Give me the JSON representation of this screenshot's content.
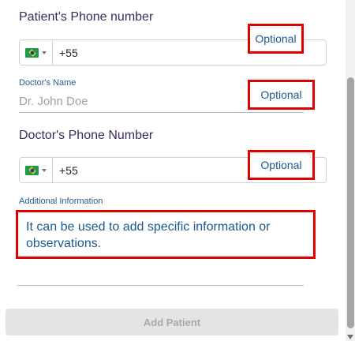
{
  "patient_phone": {
    "label": "Patient's Phone number",
    "country_flag": "brazil-flag-icon",
    "value": "+55",
    "optional_tag": "Optional"
  },
  "doctor_name": {
    "label": "Doctor's Name",
    "placeholder": "Dr. John Doe",
    "optional_tag": "Optional"
  },
  "doctor_phone": {
    "label": "Doctor's Phone Number",
    "country_flag": "brazil-flag-icon",
    "value": "+55",
    "optional_tag": "Optional"
  },
  "additional_information": {
    "label": "Additional Information",
    "annotation": "It can be used to add specific information or observations."
  },
  "submit": {
    "label": "Add Patient"
  },
  "colors": {
    "label_purple": "#3d2a5c",
    "label_blue": "#2a5a8a",
    "annotation_red": "#e00000",
    "annotation_text": "#1a5a8f",
    "button_disabled_bg": "#e4e4e4",
    "button_disabled_text": "#a8a8a8"
  }
}
